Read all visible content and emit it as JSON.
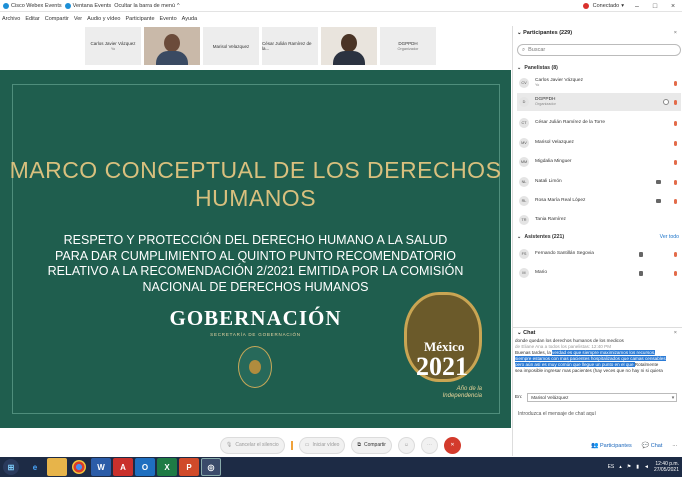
{
  "titlebar": {
    "app1": "Cisco Webex Events",
    "app2": "Ventana Events",
    "hide_menu": "Ocultar la barra de menú",
    "hide_caret": "^",
    "status": "Conectado",
    "status_caret": "▾",
    "min": "–",
    "max": "□",
    "close": "×"
  },
  "menu": [
    "Archivo",
    "Editar",
    "Compartir",
    "Ver",
    "Audio y vídeo",
    "Participante",
    "Evento",
    "Ayuda"
  ],
  "videos": [
    {
      "name": "Carlos Javier Vázquez",
      "sub": "Yo"
    },
    {
      "name": ""
    },
    {
      "name": "Marisol Velazquez"
    },
    {
      "name": "César Julián Ramírez de la..."
    },
    {
      "name": ""
    },
    {
      "name": "DGPPDH",
      "sub": "Organizador"
    }
  ],
  "slide": {
    "title_line1": "MARCO CONCEPTUAL DE LOS DERECHOS",
    "title_line2": "HUMANOS",
    "sub_line1": "RESPETO Y PROTECCIÓN DEL DERECHO HUMANO A LA SALUD",
    "sub_line2": "PARA DAR CUMPLIMIENTO AL QUINTO PUNTO RECOMENDATORIO",
    "sub_line3": "RELATIVO A LA RECOMENDACIÓN 2/2021 EMITIDA POR LA COMISIÓN",
    "sub_line4": "NACIONAL DE DERECHOS HUMANOS",
    "org": "GOBERNACIÓN",
    "org_sub": "SECRETARÍA DE GOBERNACIÓN",
    "logo_country": "México",
    "logo_year": "2021",
    "logo_sub1": "Año de la",
    "logo_sub2": "Independencia"
  },
  "controls": {
    "mute": "Cancelar el silencio",
    "video": "Iniciar vídeo",
    "share": "Compartir"
  },
  "panel": {
    "participants_title": "Participantes (229)",
    "close": "×",
    "search_placeholder": "Buscar",
    "panelists_title": "Panelistas (8)",
    "panelists": [
      {
        "initials": "CV",
        "name": "Carlos Javier Vázquez",
        "role": "Yo"
      },
      {
        "initials": "D",
        "name": "DGPPDH",
        "role": "Organizador"
      },
      {
        "initials": "CT",
        "name": "César Julián Ramírez de la Torre",
        "role": ""
      },
      {
        "initials": "MV",
        "name": "Marisol Velazquez",
        "role": ""
      },
      {
        "initials": "MM",
        "name": "Migdalia Minguer",
        "role": ""
      },
      {
        "initials": "NL",
        "name": "Natali Limón",
        "role": ""
      },
      {
        "initials": "RL",
        "name": "Rosa María Real López",
        "role": ""
      },
      {
        "initials": "TR",
        "name": "Tania Ramírez",
        "role": ""
      }
    ],
    "attendees_title": "Asistentes (221)",
    "view_all": "Ver todo",
    "attendees": [
      {
        "initials": "FS",
        "name": "Fernando Santillán Segovia"
      },
      {
        "initials": "M",
        "name": "Mario"
      }
    ],
    "chat_title": "Chat",
    "chat_lines": {
      "l1": "donde quedan los derechos humanos de los medicos",
      "l2": "de Eliane Ana a todos los panelistas: 12:40 PM",
      "l3a": "Buenas tardes, la ",
      "l3b": "verdad es que siempre maximizamos los recursos,",
      "l4": "siempre estamos con mas pacientes hospitalizados que camas censables",
      "l5a": "pero aún así es muy común que llegue un punto en el que ",
      "l5b": "Rotalmente",
      "l6": "sea imposible ingresar mas pacientes (hay veces que no hay ni si quiera"
    },
    "to_label": "En:",
    "to_value": "Marisol Velázquez",
    "input_placeholder": "Introduzca el mensaje de chat aquí",
    "footer_participants": "Participantes",
    "footer_chat": "Chat",
    "footer_more": "..."
  },
  "taskbar": {
    "apps": [
      "start",
      "ie",
      "explorer",
      "chrome",
      "word",
      "acrobat",
      "outlook",
      "excel",
      "powerpoint",
      "webex"
    ],
    "lang": "ES",
    "time": "12:40 p.m.",
    "date": "27/05/2021"
  },
  "colors": {
    "slide_bg": "#1f5e4e",
    "slide_gold": "#d9c07e",
    "accent": "#1a73c9",
    "end_call": "#d33b2c",
    "taskbar": "#1d2b45"
  }
}
